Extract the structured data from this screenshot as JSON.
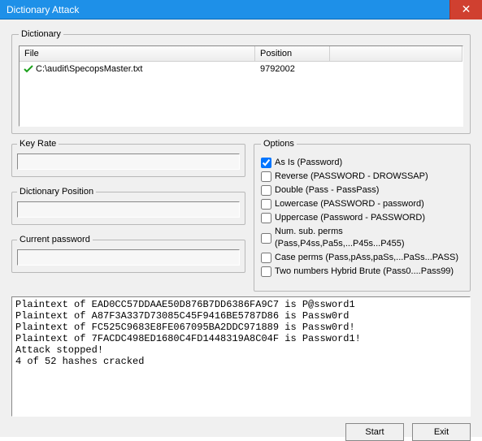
{
  "window": {
    "title": "Dictionary Attack",
    "close_symbol": "✕"
  },
  "groups": {
    "dictionary": "Dictionary",
    "key_rate": "Key Rate",
    "dict_pos": "Dictionary Position",
    "cur_pwd": "Current password",
    "options": "Options"
  },
  "table": {
    "header_file": "File",
    "header_position": "Position",
    "rows": [
      {
        "file": "C:\\audit\\SpecopsMaster.txt",
        "position": "9792002"
      }
    ]
  },
  "fields": {
    "key_rate": "",
    "dict_pos": "",
    "cur_pwd": ""
  },
  "options": [
    {
      "checked": true,
      "label": "As Is (Password)"
    },
    {
      "checked": false,
      "label": "Reverse (PASSWORD - DROWSSAP)"
    },
    {
      "checked": false,
      "label": "Double (Pass - PassPass)"
    },
    {
      "checked": false,
      "label": "Lowercase (PASSWORD - password)"
    },
    {
      "checked": false,
      "label": "Uppercase (Password - PASSWORD)"
    },
    {
      "checked": false,
      "label": "Num. sub. perms (Pass,P4ss,Pa5s,...P45s...P455)"
    },
    {
      "checked": false,
      "label": "Case perms (Pass,pAss,paSs,...PaSs...PASS)"
    },
    {
      "checked": false,
      "label": "Two numbers Hybrid Brute (Pass0....Pass99)"
    }
  ],
  "output": "Plaintext of EAD0CC57DDAAE50D876B7DD6386FA9C7 is P@ssword1\nPlaintext of A87F3A337D73085C45F9416BE5787D86 is Passw0rd\nPlaintext of FC525C9683E8FE067095BA2DDC971889 is Passw0rd!\nPlaintext of 7FACDC498ED1680C4FD1448319A8C04F is Password1!\nAttack stopped!\n4 of 52 hashes cracked",
  "buttons": {
    "start": "Start",
    "exit": "Exit"
  }
}
